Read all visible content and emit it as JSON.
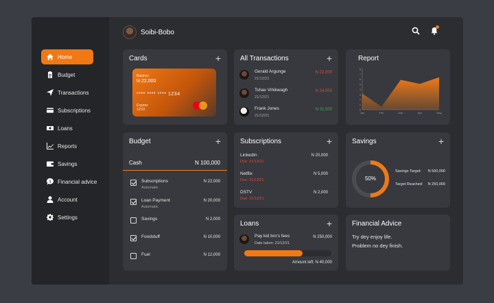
{
  "user": {
    "name": "Soibi-Bobo"
  },
  "sidebar": {
    "items": [
      {
        "label": "Home",
        "icon": "home-icon"
      },
      {
        "label": "Budget",
        "icon": "clipboard-icon"
      },
      {
        "label": "Transactions",
        "icon": "send-icon"
      },
      {
        "label": "Subscriptions",
        "icon": "credit-card-icon"
      },
      {
        "label": "Loans",
        "icon": "money-icon"
      },
      {
        "label": "Reports",
        "icon": "chart-icon"
      },
      {
        "label": "Savings",
        "icon": "wallet-icon"
      },
      {
        "label": "Financial advice",
        "icon": "advice-icon"
      },
      {
        "label": "Account",
        "icon": "user-icon"
      },
      {
        "label": "Settings",
        "icon": "gear-icon"
      }
    ]
  },
  "cards": {
    "title": "Cards",
    "balance_label": "Balance",
    "balance": "N 22,000",
    "number": "**** **** **** 1234",
    "expires_label": "Expires",
    "expires": "12/22"
  },
  "transactions": {
    "title": "All Transactions",
    "items": [
      {
        "name": "Gerald Argunge",
        "date": "21/12/21",
        "amount": "N 22,000",
        "type": "debit"
      },
      {
        "name": "Tshav Vihikwagh",
        "date": "21/12/21",
        "amount": "N 34,000",
        "type": "debit"
      },
      {
        "name": "Frank Jones",
        "date": "21/12/21",
        "amount": "N 32,000",
        "type": "credit"
      }
    ]
  },
  "report": {
    "title": "Report"
  },
  "chart_data": {
    "type": "area",
    "categories": [
      "Jan",
      "Feb",
      "Mar",
      "Apr",
      "May"
    ],
    "values": [
      3.2,
      0.6,
      5.9,
      5.1,
      6.4
    ],
    "ylim": [
      0,
      8
    ],
    "yticks": [
      "0",
      "1",
      "2",
      "3",
      "4",
      "5",
      "6",
      "7",
      "8"
    ],
    "color": "#f07916"
  },
  "budget": {
    "title": "Budget",
    "cash_label": "Cash",
    "cash_amount": "N 100,000",
    "items": [
      {
        "name": "Subscriptions",
        "sub": "Automatic",
        "amount": "N 22,000",
        "checked": true
      },
      {
        "name": "Loan Payment",
        "sub": "Automatic",
        "amount": "N 20,000",
        "checked": true
      },
      {
        "name": "Savings",
        "sub": "",
        "amount": "N 2,000",
        "checked": false
      },
      {
        "name": "Foodstuff",
        "sub": "",
        "amount": "N 10,000",
        "checked": true
      },
      {
        "name": "Fuel",
        "sub": "",
        "amount": "N 12,000",
        "checked": false
      }
    ]
  },
  "subscriptions": {
    "title": "Subscriptions",
    "items": [
      {
        "name": "LinkedIn",
        "due": "Due: 21/12/21",
        "amount": "N 20,000"
      },
      {
        "name": "Netflix",
        "due": "Due: 21/12/21",
        "amount": "N 5,000"
      },
      {
        "name": "DSTV",
        "due": "Due: 21/12/21",
        "amount": "N 2,000"
      }
    ]
  },
  "savings": {
    "title": "Savings",
    "percent_label": "50%",
    "progress": 0.5,
    "target_label": "Savings Target:",
    "target": "N 500,000",
    "reached_label": "Target Reached:",
    "reached": "N 250,000"
  },
  "loans": {
    "title": "Loans",
    "item_name": "Pay kid bro's fees",
    "item_date": "Date taken: 21/12/21",
    "item_amount": "N 250,000",
    "progress": 0.67,
    "amount_left": "Amount left: N 40,000"
  },
  "advice": {
    "title": "Financial Advice",
    "line1": "Try dey enjoy life.",
    "line2": "Problem no dey finish."
  },
  "colors": {
    "accent": "#f07916",
    "panel": "#37393e",
    "background": "#2b2d31",
    "sidebar": "#242528"
  }
}
